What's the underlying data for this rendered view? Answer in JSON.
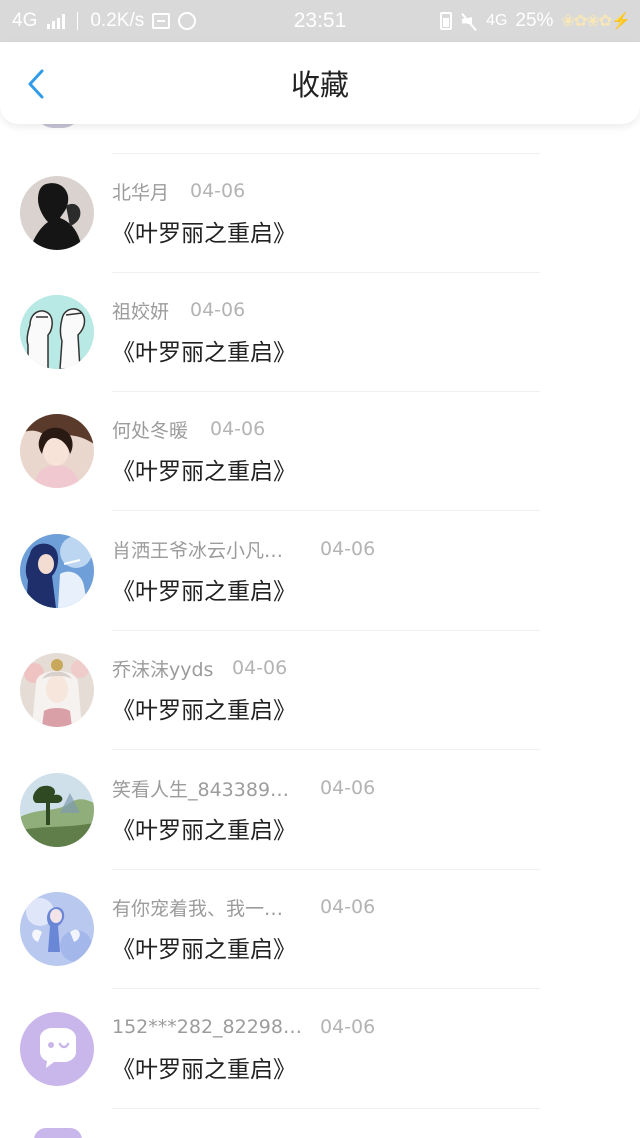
{
  "status_bar": {
    "network_left": "4G",
    "speed": "0.2K/s",
    "time": "23:51",
    "network_right": "4G",
    "battery": "25%",
    "flowers": "❀✿❀✿⚡"
  },
  "header": {
    "title": "收藏",
    "back_icon": "chevron-left-icon"
  },
  "items": [
    {
      "name": "北华月",
      "date": "04-06",
      "title": "《叶罗丽之重启》",
      "avatar_style": "silhouette"
    },
    {
      "name": "祖姣妍",
      "date": "04-06",
      "title": "《叶罗丽之重启》",
      "avatar_style": "sketch-duo"
    },
    {
      "name": "何处冬暖",
      "date": "04-06",
      "title": "《叶罗丽之重启》",
      "avatar_style": "girl-pink"
    },
    {
      "name": "肖洒王爷冰云小凡…",
      "date": "04-06",
      "title": "《叶罗丽之重启》",
      "avatar_style": "blue-anime"
    },
    {
      "name": "乔沫沫yyds",
      "date": "04-06",
      "title": "《叶罗丽之重启》",
      "avatar_style": "white-hair"
    },
    {
      "name": "笑看人生_843389…",
      "date": "04-06",
      "title": "《叶罗丽之重启》",
      "avatar_style": "landscape"
    },
    {
      "name": "有你宠着我、我一…",
      "date": "04-06",
      "title": "《叶罗丽之重启》",
      "avatar_style": "fairy"
    },
    {
      "name": "152***282_82298…",
      "date": "04-06",
      "title": "《叶罗丽之重启》",
      "avatar_style": "default-purple"
    }
  ],
  "colors": {
    "accent": "#2f9bea",
    "status_bar_bg": "#d9d9d9",
    "name_gray": "#9c9c9c",
    "date_gray": "#b4b4b4",
    "default_avatar": "#c9b6ea"
  }
}
